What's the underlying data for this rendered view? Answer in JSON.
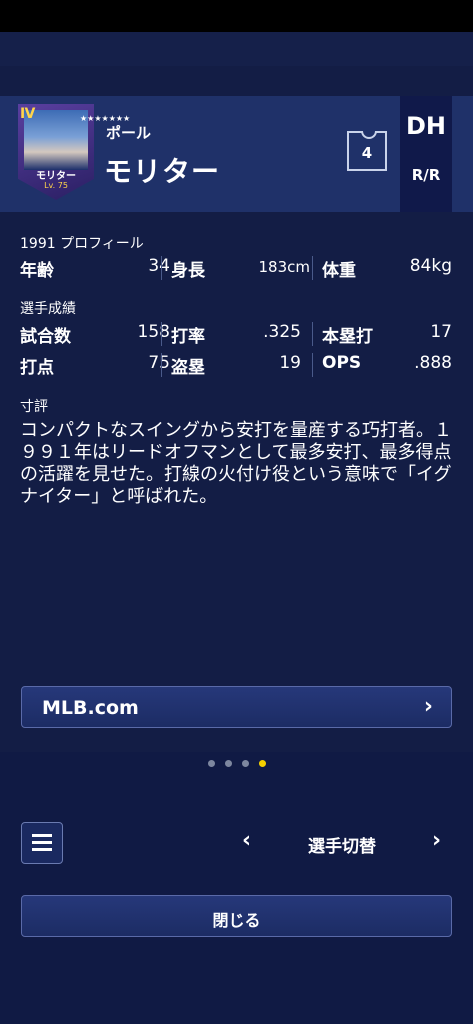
{
  "player": {
    "rank": "Ⅳ",
    "stars": "★★★★★★★",
    "card_name": "モリター",
    "card_level": "Lv. 75",
    "first_name": "ポール",
    "last_name": "モリター",
    "number": "4",
    "position": "DH",
    "hand": "R/R"
  },
  "profile": {
    "title": "1991 プロフィール",
    "age_label": "年齢",
    "age": "34",
    "height_label": "身長",
    "height": "183cm",
    "weight_label": "体重",
    "weight": "84kg"
  },
  "stats": {
    "title": "選手成績",
    "games_label": "試合数",
    "games": "158",
    "avg_label": "打率",
    "avg": ".325",
    "hr_label": "本塁打",
    "hr": "17",
    "rbi_label": "打点",
    "rbi": "75",
    "sb_label": "盗塁",
    "sb": "19",
    "ops_label": "OPS",
    "ops": ".888"
  },
  "comment": {
    "title": "寸評",
    "text": "コンパクトなスイングから安打を量産する巧打者。１９９１年はリードオフマンとして最多安打、最多得点の活躍を見せた。打線の火付け役という意味で「イグナイター」と呼ばれた。"
  },
  "link": {
    "label": "MLB.com",
    "arrow": "›"
  },
  "pager": {
    "count": 4,
    "active": 3,
    "active_color": "#f5d000"
  },
  "nav": {
    "prev": "‹",
    "label": "選手切替",
    "next": "›"
  },
  "close_label": "閉じる"
}
